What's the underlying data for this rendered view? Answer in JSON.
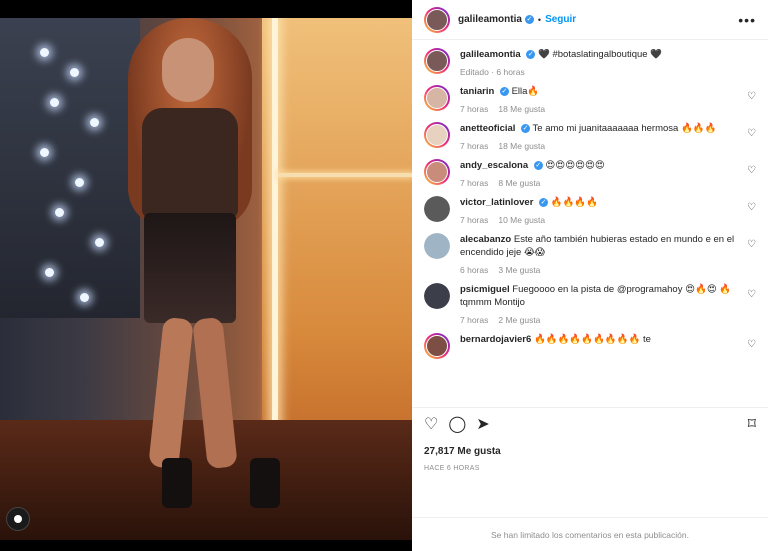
{
  "header": {
    "username": "galileamontia",
    "separator": "•",
    "follow_label": "Seguir",
    "more_icon": "more-horizontal-icon"
  },
  "caption": {
    "username": "galileamontia",
    "text": "🖤 #botaslatingalboutique 🖤",
    "meta": "Editado · 6 horas"
  },
  "comments": [
    {
      "username": "taniarin",
      "verified": true,
      "text": "Ella🔥",
      "time": "7 horas",
      "likes": "18 Me gusta"
    },
    {
      "username": "anetteoficial",
      "verified": true,
      "text": "Te amo mi juanitaaaaaaa hermosa 🔥🔥🔥",
      "time": "7 horas",
      "likes": "18 Me gusta"
    },
    {
      "username": "andy_escalona",
      "verified": true,
      "text": "😍😍😍😍😍😍",
      "time": "7 horas",
      "likes": "8 Me gusta"
    },
    {
      "username": "victor_latinlover",
      "verified": true,
      "text": "🔥🔥🔥🔥",
      "time": "7 horas",
      "likes": "10 Me gusta"
    },
    {
      "username": "alecabanzo",
      "verified": false,
      "text": "Este año también hubieras estado en mundo e en el encendido jeje 😭😱",
      "time": "6 horas",
      "likes": "3 Me gusta"
    },
    {
      "username": "psicmiguel",
      "verified": false,
      "text": "Fuegoooo en la pista de @programahoy 😍🔥😍 🔥 tqmmm Montijo",
      "time": "7 horas",
      "likes": "2 Me gusta"
    },
    {
      "username": "bernardojavier6",
      "verified": false,
      "text": "🔥🔥🔥🔥🔥🔥🔥🔥🔥 te",
      "time": "",
      "likes": ""
    }
  ],
  "actions": {
    "like_icon": "heart-icon",
    "comment_icon": "comment-icon",
    "share_icon": "share-icon",
    "save_icon": "bookmark-icon",
    "likes": "27,817 Me gusta",
    "timestamp": "HACE 6 HORAS"
  },
  "footer": {
    "closed_text": "Se han limitado los comentarios en esta publicación."
  },
  "colors": {
    "accent": "#0095f6",
    "verified": "#3897f0",
    "muted": "#8e8e8e"
  }
}
